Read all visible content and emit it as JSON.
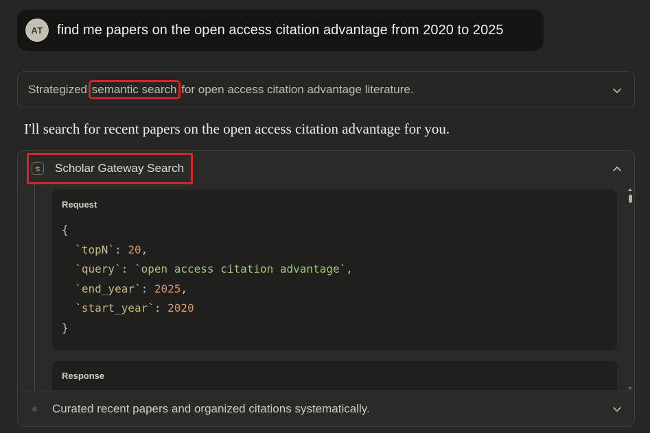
{
  "user": {
    "avatar_initials": "AT",
    "message": "find me papers on the open access citation advantage from 2020 to 2025"
  },
  "thought": {
    "prefix": "Strategized ",
    "highlight": "semantic search",
    "suffix": " for open access citation advantage literature.",
    "icon": "chevron-down-icon"
  },
  "assistant": {
    "text": "I'll search for recent papers on the open access citation advantage for you."
  },
  "tool": {
    "badge": "S",
    "title": "Scholar Gateway Search",
    "collapse_icon": "chevron-up-icon",
    "request": {
      "label": "Request",
      "params": [
        {
          "key": "`topN`",
          "value": "20",
          "type": "number"
        },
        {
          "key": "`query`",
          "value": "`open access citation advantage`",
          "type": "string"
        },
        {
          "key": "`end_year`",
          "value": "2025",
          "type": "number"
        },
        {
          "key": "`start_year`",
          "value": "2020",
          "type": "number"
        }
      ]
    },
    "response": {
      "label": "Response"
    },
    "footer": {
      "text": "Curated recent papers and organized citations systematically.",
      "icon": "chevron-down-icon"
    }
  },
  "colors": {
    "highlight_box": "#d3252a",
    "background": "#262624",
    "code_key": "#c6ba7f",
    "code_number": "#d6976a",
    "code_string": "#a7c47b"
  }
}
